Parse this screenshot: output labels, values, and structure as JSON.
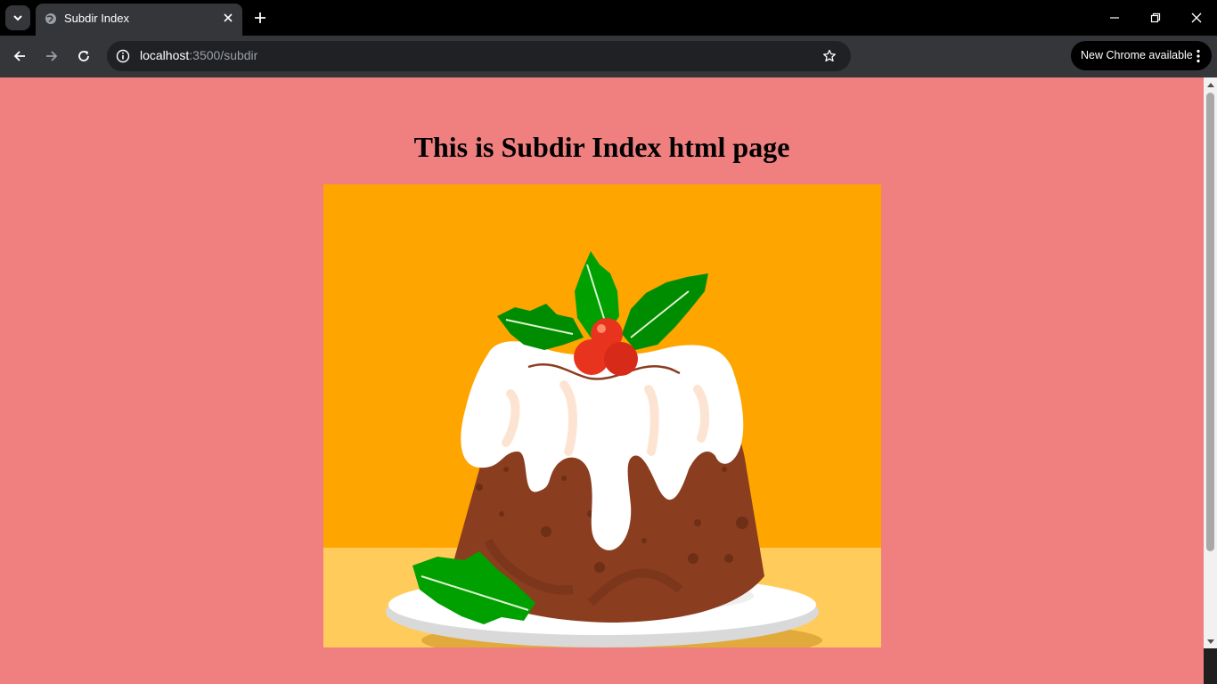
{
  "browser": {
    "tab": {
      "title": "Subdir Index"
    },
    "omnibox": {
      "host": "localhost",
      "rest": ":3500/subdir"
    },
    "update_button": {
      "label": "New Chrome available"
    },
    "icons": {
      "tab_search": "chevron-down-icon",
      "favicon": "globe-icon",
      "tab_close": "close-icon",
      "new_tab": "plus-icon",
      "back": "arrow-left-icon",
      "forward": "arrow-right-icon",
      "reload": "reload-icon",
      "site_info": "info-icon",
      "bookmark": "star-icon",
      "menu": "kebab-menu-icon",
      "minimize": "minimize-icon",
      "restore": "restore-icon",
      "close_window": "close-icon"
    },
    "colors": {
      "tabstrip": "#000000",
      "toolbar": "#35363a",
      "omnibox": "#202124"
    }
  },
  "page": {
    "heading": "This is Subdir Index html page",
    "background_color": "#f08080",
    "image": {
      "subject": "christmas-pudding-illustration",
      "background_color": "#ffa500"
    }
  }
}
